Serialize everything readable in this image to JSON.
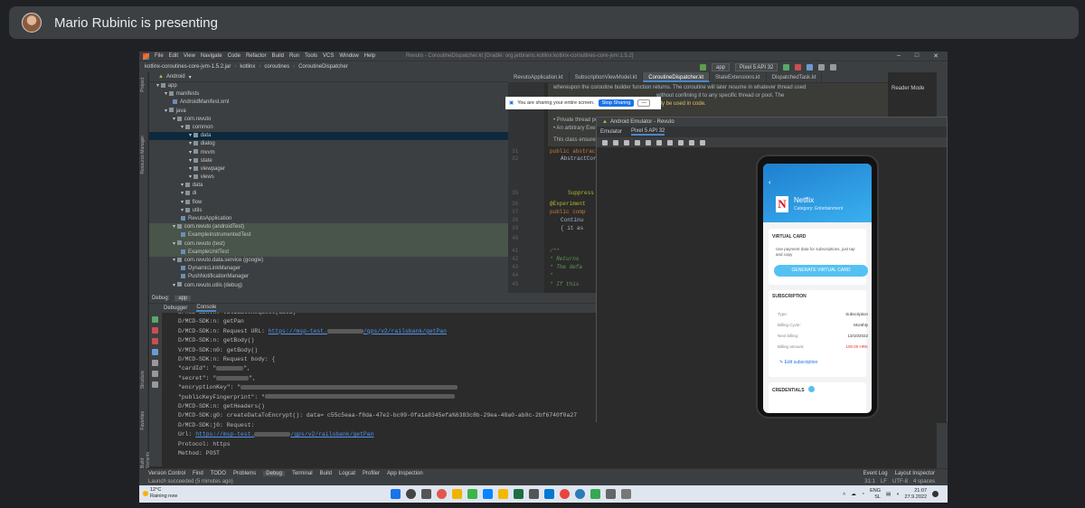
{
  "meet": {
    "presenter_text": "Mario Rubinic is presenting"
  },
  "ide": {
    "menu": [
      "File",
      "Edit",
      "View",
      "Navigate",
      "Code",
      "Refactor",
      "Build",
      "Run",
      "Tools",
      "VCS",
      "Window",
      "Help"
    ],
    "window_title": "Revuto - CoroutineDispatcher.kt [Gradle: org.jetbrains.kotlinx:kotlinx-coroutines-core-jvm:1.5.2]",
    "breadcrumb": [
      "kotlinx-coroutines-core-jvm-1.5.2.jar",
      "kotlinx",
      "coroutines",
      "CoroutineDispatcher"
    ],
    "run_config": "app",
    "device": "Pixel 5 API 32",
    "project_view": "Android",
    "tree": [
      {
        "indent": 0,
        "label": "app",
        "type": "folder"
      },
      {
        "indent": 1,
        "label": "manifests",
        "type": "folder"
      },
      {
        "indent": 2,
        "label": "AndroidManifest.xml",
        "type": "file"
      },
      {
        "indent": 1,
        "label": "java",
        "type": "folder"
      },
      {
        "indent": 2,
        "label": "com.revuto",
        "type": "folder"
      },
      {
        "indent": 3,
        "label": "common",
        "type": "folder"
      },
      {
        "indent": 4,
        "label": "data",
        "type": "folder",
        "state": "selected"
      },
      {
        "indent": 4,
        "label": "dialog",
        "type": "folder"
      },
      {
        "indent": 4,
        "label": "mvvm",
        "type": "folder"
      },
      {
        "indent": 4,
        "label": "state",
        "type": "folder"
      },
      {
        "indent": 4,
        "label": "viewpager",
        "type": "folder"
      },
      {
        "indent": 4,
        "label": "views",
        "type": "folder"
      },
      {
        "indent": 3,
        "label": "data",
        "type": "folder"
      },
      {
        "indent": 3,
        "label": "di",
        "type": "folder"
      },
      {
        "indent": 3,
        "label": "flow",
        "type": "folder"
      },
      {
        "indent": 3,
        "label": "utils",
        "type": "folder"
      },
      {
        "indent": 3,
        "label": "RevutoApplication",
        "type": "file"
      },
      {
        "indent": 2,
        "label": "com.revuto (androidTest)",
        "type": "folder",
        "state": "test"
      },
      {
        "indent": 3,
        "label": "ExampleInstrumentedTest",
        "type": "file",
        "state": "test"
      },
      {
        "indent": 2,
        "label": "com.revuto (test)",
        "type": "folder",
        "state": "test"
      },
      {
        "indent": 3,
        "label": "ExampleUnitTest",
        "type": "file",
        "state": "test"
      },
      {
        "indent": 2,
        "label": "com.revuto.data.service (google)",
        "type": "folder"
      },
      {
        "indent": 3,
        "label": "DynamicLinkManager",
        "type": "file"
      },
      {
        "indent": 3,
        "label": "PushNotificationManager",
        "type": "file"
      },
      {
        "indent": 2,
        "label": "com.revuto.utils (debug)",
        "type": "folder"
      }
    ],
    "editor_tabs": [
      "RevutoApplication.kt",
      "SubscriptionViewModel.kt",
      "CoroutineDispatcher.kt",
      "StateExtensions.kt",
      "DispatchedTask.kt"
    ],
    "active_tab": 2,
    "reader_mode": "Reader Mode",
    "doc_lines": [
      "whereupon the coroutine builder function returns. The coroutine will later resume in whatever thread used",
      "without confining it to any specific thread or pool. The",
      "ally be used in code.",
      "• Private thread pools can be created with newSingleThreadContext and newFixedThreadPoolContext.",
      "• An arbitrary Exe",
      "This class ensures"
    ],
    "code_lines": [
      {
        "ln": "31",
        "text": "public abstract"
      },
      {
        "ln": "32",
        "text": "AbstractCor"
      },
      {
        "ln": "35",
        "text": "Suppress"
      },
      {
        "ln": "36",
        "text": "@Experiment"
      },
      {
        "ln": "37",
        "text": "public comp"
      },
      {
        "ln": "38",
        "text": "Continu"
      },
      {
        "ln": "39",
        "text": "{ it as"
      },
      {
        "ln": "40",
        "text": ""
      },
      {
        "ln": "41",
        "text": "/**"
      },
      {
        "ln": "42",
        "text": " * Returns"
      },
      {
        "ln": "43",
        "text": " * The defa"
      },
      {
        "ln": "44",
        "text": " *"
      },
      {
        "ln": "45",
        "text": " * If this"
      }
    ],
    "share_banner": {
      "text": "You are sharing your entire screen.",
      "stop": "Stop Sharing",
      "hide": "Hide"
    },
    "emulator": {
      "title": "Android Emulator - Revuto",
      "tab_label": "Emulator",
      "device_tab": "Pixel 5 API 32",
      "app": {
        "service_name": "Netflix",
        "service_category": "Category: Entertainment",
        "virtual_card_title": "VIRTUAL CARD",
        "virtual_card_desc": "Use payment data for subscriptions, just tap and copy",
        "generate_button": "GENERATE VIRTUAL CARD",
        "subscription_title": "SUBSCRIPTION",
        "rows": [
          {
            "k": "Type:",
            "v": "Subscription"
          },
          {
            "k": "Billing Cycle:",
            "v": "Monthly"
          },
          {
            "k": "Next billing:",
            "v": "13/10/2022"
          },
          {
            "k": "Billing amount:",
            "v": "100.00 HRK"
          }
        ],
        "edit_link": "Edit subscription",
        "credentials_title": "CREDENTIALS"
      }
    },
    "debug": {
      "tab_label": "Debug:",
      "config": "app",
      "subtabs": [
        "Debugger",
        "Console"
      ],
      "console_lines": [
        {
          "prefix": "D/MCD-SDK:n: validateRequest(data)",
          "url": "",
          "suffix": ""
        },
        {
          "prefix": "D/MCD-SDK:n: getPan",
          "url": "",
          "suffix": ""
        },
        {
          "prefix": "D/MCD-SDK:n: Request URL: ",
          "url": "https://msp-test.",
          "suffix": ""
        },
        {
          "prefix": "D/MCD-SDK:n: getBody()",
          "url": "",
          "suffix": ""
        },
        {
          "prefix": "V/MCD-SDK:n0: getBody()",
          "url": "",
          "suffix": ""
        },
        {
          "prefix": "D/MCD-SDK:n: Request body: {",
          "url": "",
          "suffix": ""
        },
        {
          "prefix": "      \"cardId\": \"",
          "url": "",
          "suffix": "\","
        },
        {
          "prefix": "      \"secret\": \"",
          "url": "",
          "suffix": "\","
        },
        {
          "prefix": "      \"encryptionKey\": \"",
          "url": "",
          "suffix": ""
        },
        {
          "prefix": "      \"publicKeyFingerprint\": \"",
          "url": "",
          "suffix": ""
        },
        {
          "prefix": "D/MCD-SDK:n: getHeaders()",
          "url": "",
          "suffix": ""
        },
        {
          "prefix": "D/MCD-SDK:g0: createDataToEncrypt(): data= c55c5eaa-f8da-47e2-bc09-0fa1a8345efa%6383c8b-29ea-48a0-ab0c-2bf6740f0a27",
          "url": "",
          "suffix": ""
        },
        {
          "prefix": "D/MCD-SDK:j0: Request:",
          "url": "",
          "suffix": ""
        },
        {
          "prefix": "           Url: ",
          "url": "https://msp-test.",
          "suffix": ""
        },
        {
          "prefix": "           Protocol: https",
          "url": "",
          "suffix": ""
        },
        {
          "prefix": "           Method: POST",
          "url": "",
          "suffix": ""
        }
      ],
      "url_tail": "/gps/v2/railsbank/getPan"
    },
    "bottom_tools": [
      "Version Control",
      "Find",
      "TODO",
      "Problems",
      "Debug",
      "Terminal",
      "Build",
      "Logcat",
      "Profiler",
      "App Inspection"
    ],
    "bottom_right": [
      "Event Log",
      "Layout Inspector"
    ],
    "status_left": "Launch succeeded (5 minutes ago)",
    "status_right": [
      "31:1",
      "LF",
      "UTF-8",
      "4 spaces"
    ]
  },
  "taskbar": {
    "temp": "12°C",
    "weather": "Raining now",
    "lang": "ENG",
    "region": "SL",
    "time": "21:07",
    "date": "27.9.2022"
  }
}
